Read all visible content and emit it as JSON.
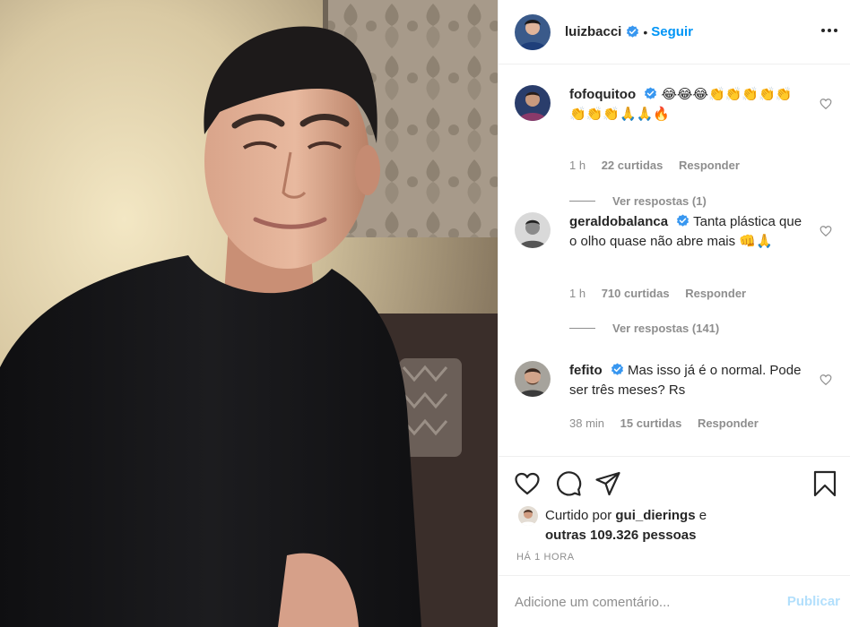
{
  "header": {
    "username": "luizbacci",
    "separator": "•",
    "follow_label": "Seguir"
  },
  "comments": [
    {
      "username": "fofoquitoo",
      "text": "😂😂😂👏👏👏👏👏👏👏👏🙏🙏🔥",
      "time": "1 h",
      "likes": "22 curtidas",
      "reply_label": "Responder",
      "view_replies": "Ver respostas (1)"
    },
    {
      "username": "geraldobalanca",
      "text": "Tanta plástica que o olho quase não abre mais 👊🙏",
      "time": "1 h",
      "likes": "710 curtidas",
      "reply_label": "Responder",
      "view_replies": "Ver respostas (141)"
    },
    {
      "username": "fefito",
      "text": "Mas isso já é o normal. Pode ser três meses? Rs",
      "time": "38 min",
      "likes": "15 curtidas",
      "reply_label": "Responder"
    }
  ],
  "likes": {
    "prefix": "Curtido por",
    "user": "gui_dierings",
    "conjunction": "e",
    "others": "outras 109.326 pessoas"
  },
  "timestamp": "HÁ 1 HORA",
  "add_comment": {
    "placeholder": "Adicione um comentário...",
    "publish_label": "Publicar"
  },
  "colors": {
    "link_blue": "#0095f6",
    "publish_disabled": "#b2dffc",
    "secondary_text": "#8e8e8e",
    "primary_text": "#262626",
    "verified_badge": "#3897f0"
  },
  "icons": [
    "verified-badge-icon",
    "more-options-icon",
    "heart-icon",
    "comment-icon",
    "share-icon",
    "bookmark-icon"
  ]
}
